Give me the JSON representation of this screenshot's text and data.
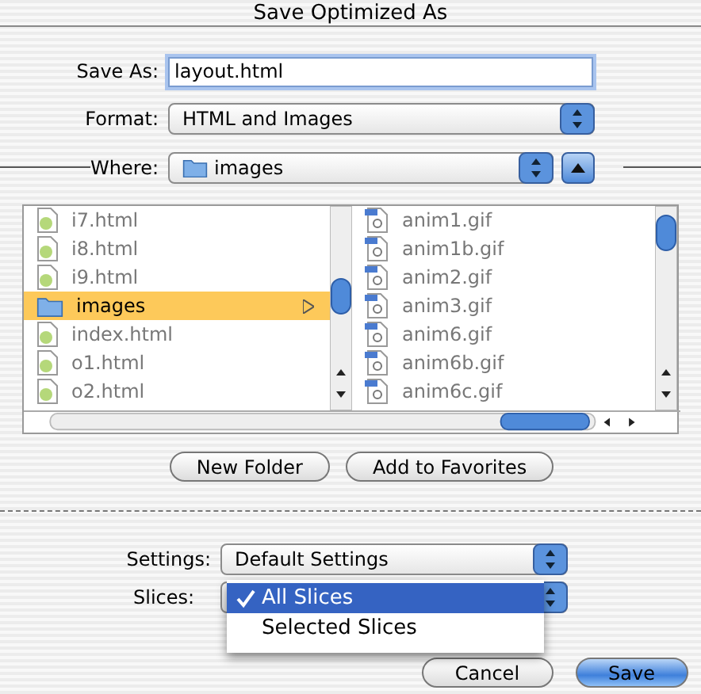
{
  "window": {
    "title": "Save Optimized As"
  },
  "save_as": {
    "label": "Save As:",
    "value": "layout.html"
  },
  "format": {
    "label": "Format:",
    "value": "HTML and Images"
  },
  "where": {
    "label": "Where:",
    "value": "images"
  },
  "file_browser": {
    "column_1": [
      {
        "name": "i7.html",
        "kind": "html",
        "selected": false
      },
      {
        "name": "i8.html",
        "kind": "html",
        "selected": false
      },
      {
        "name": "i9.html",
        "kind": "html",
        "selected": false
      },
      {
        "name": "images",
        "kind": "folder",
        "selected": true
      },
      {
        "name": "index.html",
        "kind": "html",
        "selected": false
      },
      {
        "name": "o1.html",
        "kind": "html",
        "selected": false
      },
      {
        "name": "o2.html",
        "kind": "html",
        "selected": false
      }
    ],
    "column_2": [
      {
        "name": "anim1.gif",
        "kind": "gif",
        "selected": false
      },
      {
        "name": "anim1b.gif",
        "kind": "gif",
        "selected": false
      },
      {
        "name": "anim2.gif",
        "kind": "gif",
        "selected": false
      },
      {
        "name": "anim3.gif",
        "kind": "gif",
        "selected": false
      },
      {
        "name": "anim6.gif",
        "kind": "gif",
        "selected": false
      },
      {
        "name": "anim6b.gif",
        "kind": "gif",
        "selected": false
      },
      {
        "name": "anim6c.gif",
        "kind": "gif",
        "selected": false
      }
    ]
  },
  "browser_buttons": [
    "New Folder",
    "Add to Favorites"
  ],
  "settings": {
    "label": "Settings:",
    "value": "Default Settings"
  },
  "slices": {
    "label": "Slices:"
  },
  "slices_menu": [
    {
      "label": "All Slices",
      "selected": true
    },
    {
      "label": "Selected Slices",
      "selected": false
    }
  ],
  "dialog_buttons": [
    {
      "label": "Cancel",
      "default": false
    },
    {
      "label": "Save",
      "default": true
    }
  ]
}
